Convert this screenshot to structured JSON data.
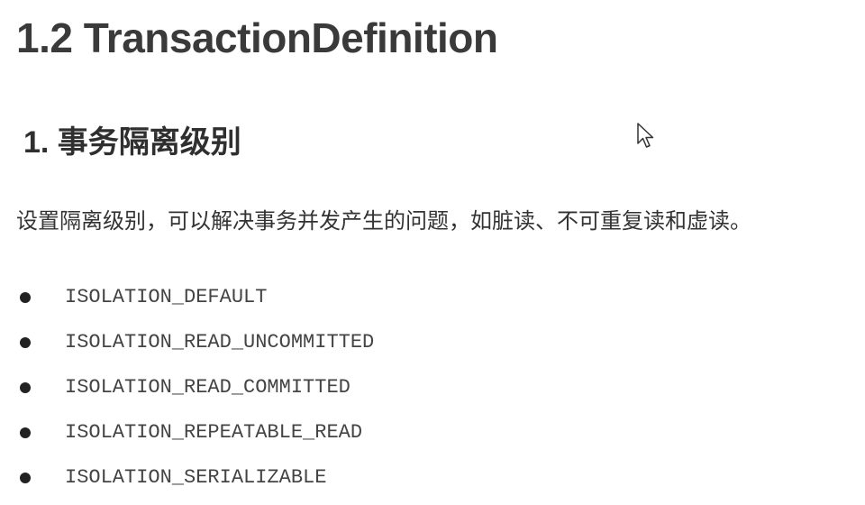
{
  "heading": "1.2 TransactionDefinition",
  "section": {
    "title": "1. 事务隔离级别",
    "description": "设置隔离级别，可以解决事务并发产生的问题，如脏读、不可重复读和虚读。"
  },
  "isolation_levels": [
    "ISOLATION_DEFAULT",
    "ISOLATION_READ_UNCOMMITTED",
    "ISOLATION_READ_COMMITTED",
    "ISOLATION_REPEATABLE_READ",
    "ISOLATION_SERIALIZABLE"
  ],
  "icons": {
    "cursor": "mouse-pointer-icon",
    "bullet": "bullet-dot-icon"
  },
  "colors": {
    "background": "#ffffff",
    "heading": "#3a3a3a",
    "text": "#333333",
    "bullet": "#222222"
  }
}
